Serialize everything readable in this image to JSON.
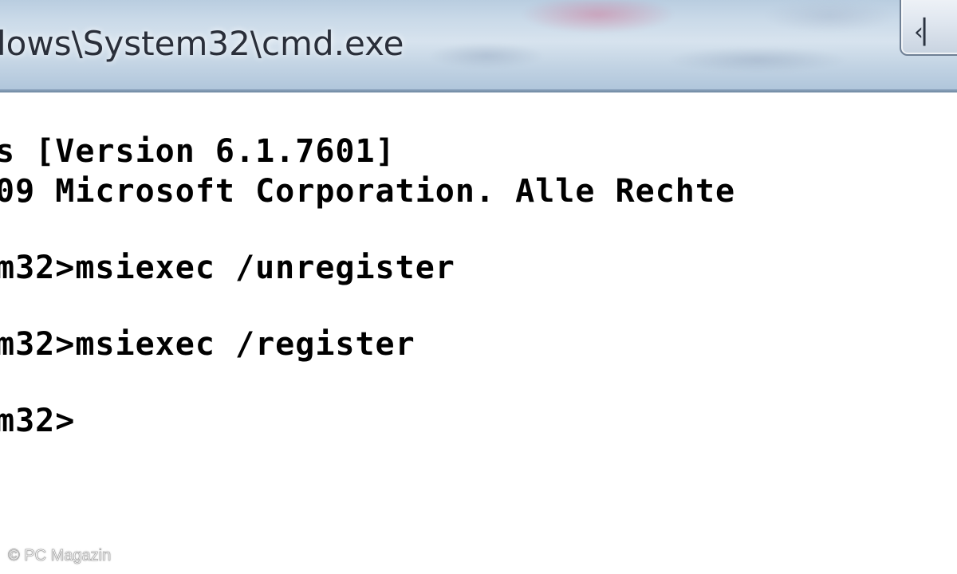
{
  "window": {
    "title": "lows\\System32\\cmd.exe",
    "minimize_glyph": "‹▏"
  },
  "console": {
    "lines": [
      "s [Version 6.1.7601]",
      "09 Microsoft Corporation. Alle Rechte",
      "m32>msiexec /unregister",
      "m32>msiexec /register",
      "m32>"
    ]
  },
  "watermark": {
    "text": "© PC Magazin"
  },
  "colors": {
    "console_background": "#ffffff",
    "console_text": "#000000",
    "titlebar": "#c9d9e8"
  },
  "icons": {
    "minimize": "minimize-icon"
  }
}
